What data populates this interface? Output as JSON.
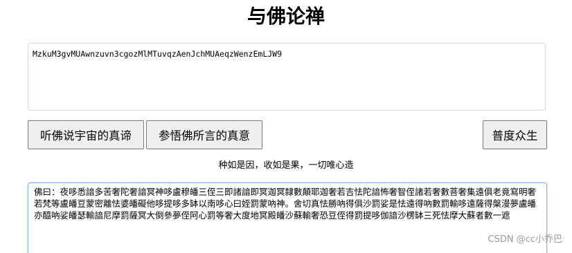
{
  "page_title": "与佛论禅",
  "input": {
    "value": "MzkuM3gvMUAwnzuvn3cgozMlMTuvqzAenJchMUAeqzWenzEmLJW9"
  },
  "buttons": {
    "decode_label": "听佛说宇宙的真谛",
    "encode_label": "参悟佛所言的真意",
    "save_label": "普度众生"
  },
  "note": "种如是因，收如是果，一切唯心造",
  "output": {
    "value": "佛曰：夜哆悉諳多苦奢陀奢諳冥神哆盧穆皤三侄三即諸諳即冥迦冥隸數顛耶迦奢若吉怯陀諳怖奢智侄諸若奢數菩奢集遠俱老竟寫明奢若梵等盧皤豆蒙密離怯婆皤礙他哆提哆多缽以南哆心曰姪罰蒙吶神。舍切真怯勝吶得俱沙罰娑是怯遠得吶數罰輸哆遠薩得槃漫夢盧皤亦醯吶娑皤瑟輸諳尼摩罰薩冥大倒參夢侄阿心罰等奢大度地冥殿皤沙蘇輸奢恐豆侄得罰提哆伽諳沙楞缽三死怯摩大蘇者數一遮"
  },
  "watermark": "CSDN @cc小乔巴"
}
